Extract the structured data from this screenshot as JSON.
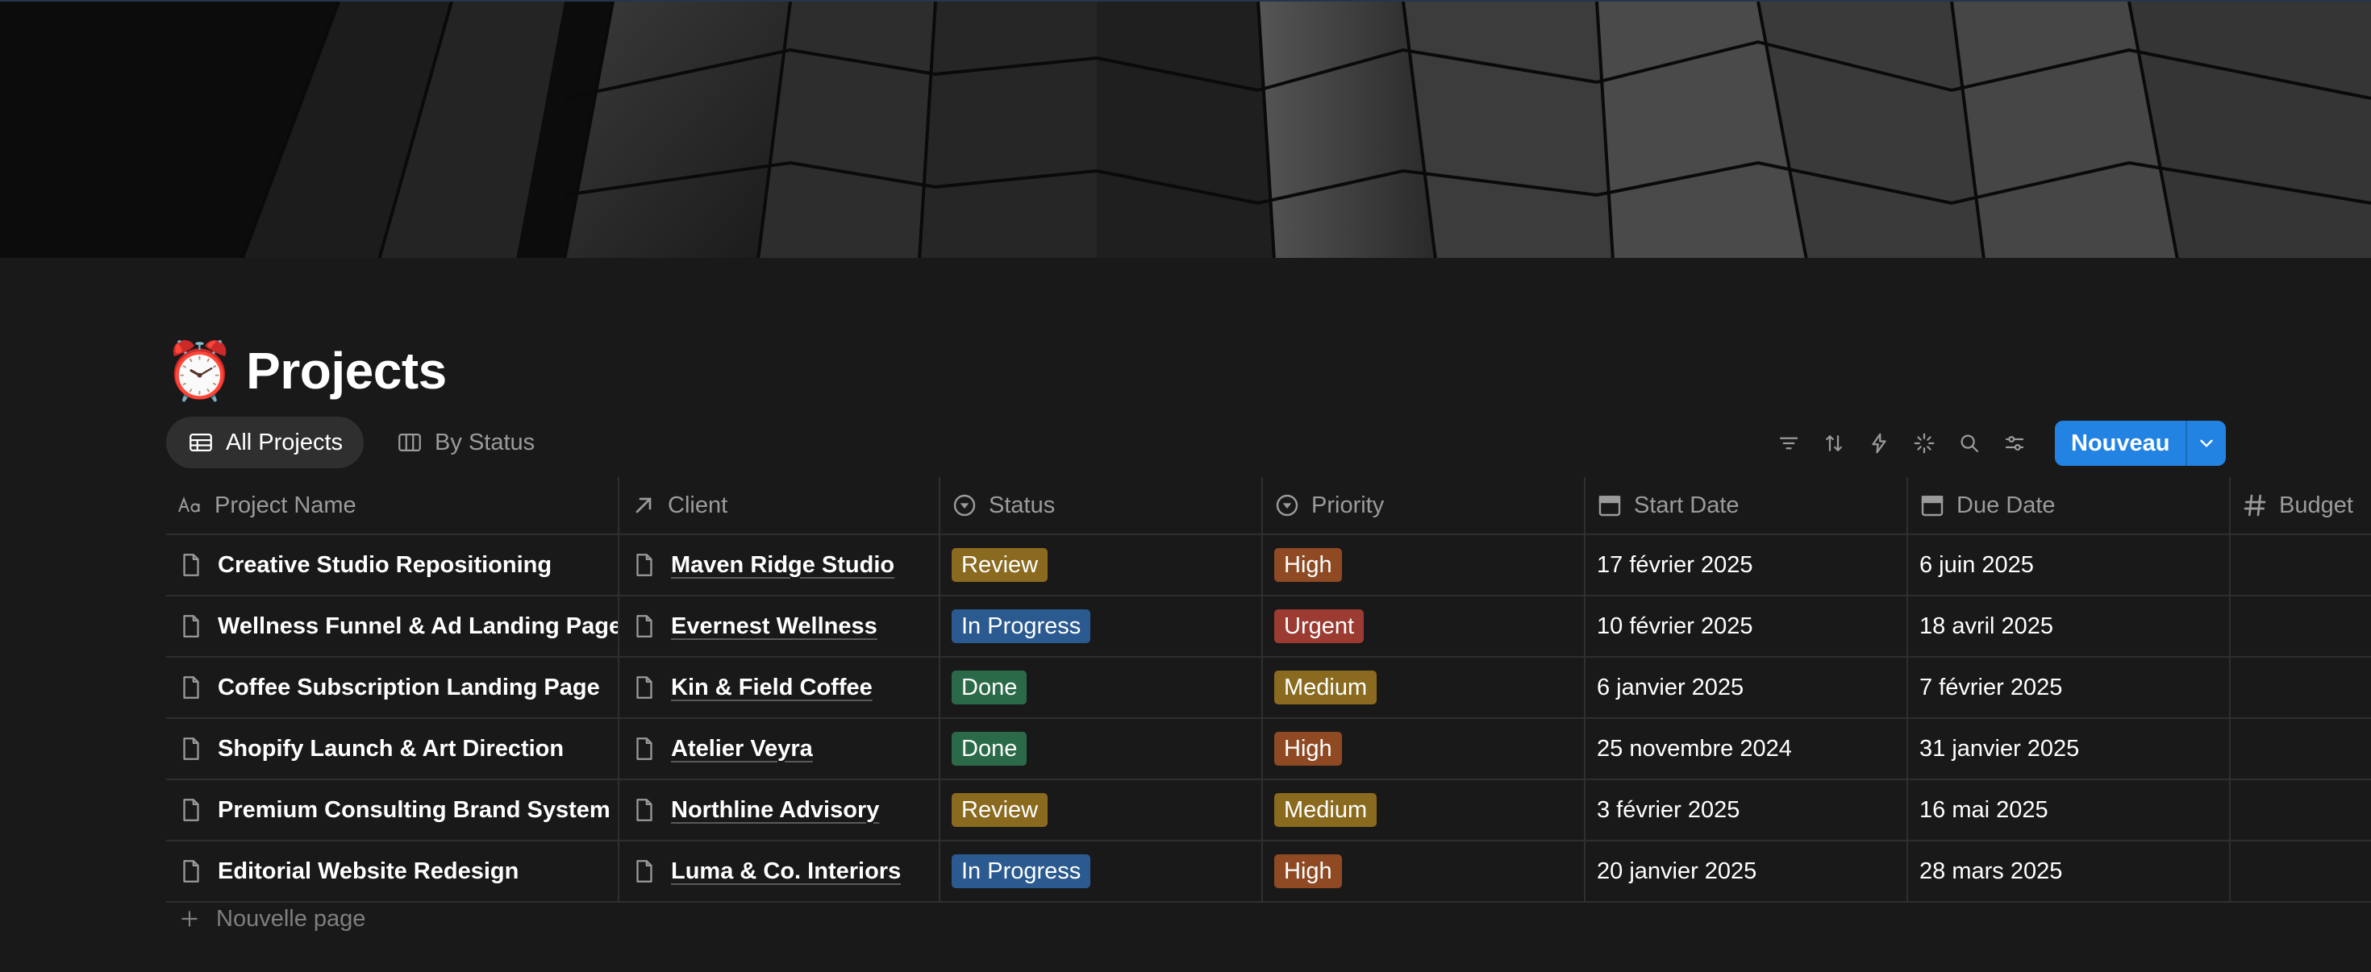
{
  "colors": {
    "accent": "#2383e2",
    "tag_review": "#8a6a1f",
    "tag_in_progress": "#2a5a8f",
    "tag_done": "#2b6a48",
    "tag_high": "#8f4a23",
    "tag_urgent": "#9b3b32",
    "tag_medium": "#8a6a1f"
  },
  "page": {
    "emoji": "⏰",
    "title": "Projects"
  },
  "views": [
    {
      "label": "All Projects",
      "icon": "table-icon",
      "active": true
    },
    {
      "label": "By Status",
      "icon": "board-icon",
      "active": false
    }
  ],
  "toolbar": {
    "icons": [
      "filter-icon",
      "sort-icon",
      "automation-icon",
      "ai-sparkle-icon",
      "search-icon",
      "settings-icon"
    ],
    "new_label": "Nouveau"
  },
  "columns": [
    {
      "label": "Project Name",
      "icon": "text-property-icon"
    },
    {
      "label": "Client",
      "icon": "relation-icon"
    },
    {
      "label": "Status",
      "icon": "status-icon"
    },
    {
      "label": "Priority",
      "icon": "select-icon"
    },
    {
      "label": "Start Date",
      "icon": "calendar-icon"
    },
    {
      "label": "Due Date",
      "icon": "calendar-icon"
    },
    {
      "label": "Budget",
      "icon": "number-icon"
    }
  ],
  "rows": [
    {
      "name": "Creative Studio Repositioning",
      "client": "Maven Ridge Studio",
      "status": "Review",
      "priority": "High",
      "start": "17 février 2025",
      "due": "6 juin 2025"
    },
    {
      "name": "Wellness Funnel & Ad Landing Pages",
      "client": "Evernest Wellness",
      "status": "In Progress",
      "priority": "Urgent",
      "start": "10 février 2025",
      "due": "18 avril 2025"
    },
    {
      "name": "Coffee Subscription Landing Page",
      "client": "Kin & Field Coffee",
      "status": "Done",
      "priority": "Medium",
      "start": "6 janvier 2025",
      "due": "7 février 2025"
    },
    {
      "name": "Shopify Launch & Art Direction",
      "client": "Atelier Veyra",
      "status": "Done",
      "priority": "High",
      "start": "25 novembre 2024",
      "due": "31 janvier 2025"
    },
    {
      "name": "Premium Consulting Brand System",
      "client": "Northline Advisory",
      "status": "Review",
      "priority": "Medium",
      "start": "3 février 2025",
      "due": "16 mai 2025"
    },
    {
      "name": "Editorial Website Redesign",
      "client": "Luma & Co. Interiors",
      "status": "In Progress",
      "priority": "High",
      "start": "20 janvier 2025",
      "due": "28 mars 2025"
    }
  ],
  "new_page_label": "Nouvelle page"
}
